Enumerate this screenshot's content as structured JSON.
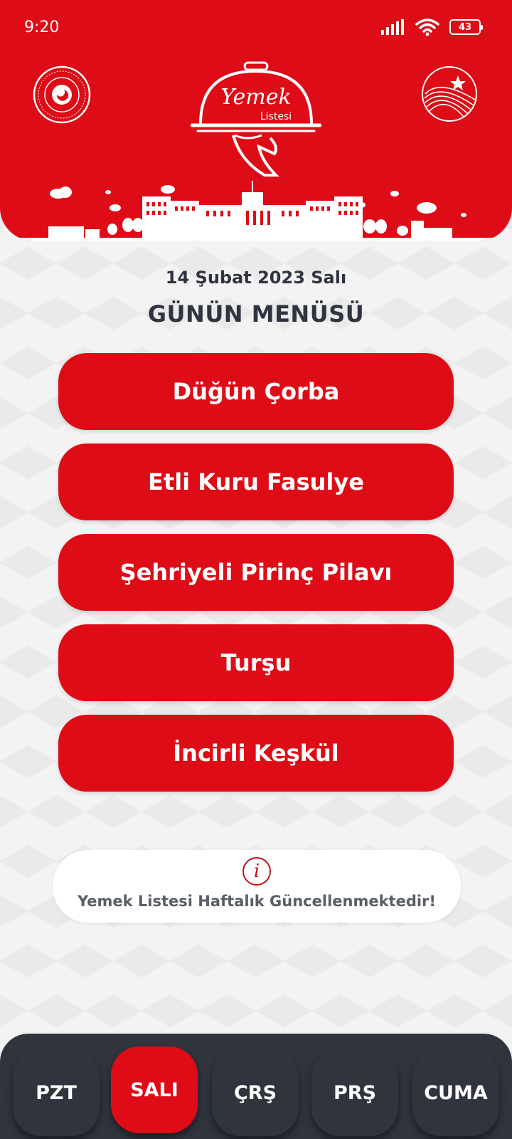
{
  "status_bar": {
    "time": "9:20",
    "battery": "43"
  },
  "header": {
    "logo_text_main": "Yemek",
    "logo_text_sub": "Listesi"
  },
  "main": {
    "date": "14 Şubat 2023 Salı",
    "title": "GÜNÜN MENÜSÜ",
    "menu_items": [
      "Düğün Çorba",
      "Etli Kuru Fasulye",
      "Şehriyeli Pirinç Pilavı",
      "Turşu",
      "İncirli Keşkül"
    ]
  },
  "info": {
    "icon": "i",
    "text": "Yemek Listesi Haftalık Güncellenmektedir!"
  },
  "bottom_nav": {
    "tabs": [
      "PZT",
      "SALI",
      "ÇRŞ",
      "PRŞ",
      "CUMA"
    ],
    "active": "SALI"
  },
  "colors": {
    "primary_red": "#dd0c16",
    "dark_nav": "#30343d",
    "text_dark": "#2f3440"
  }
}
